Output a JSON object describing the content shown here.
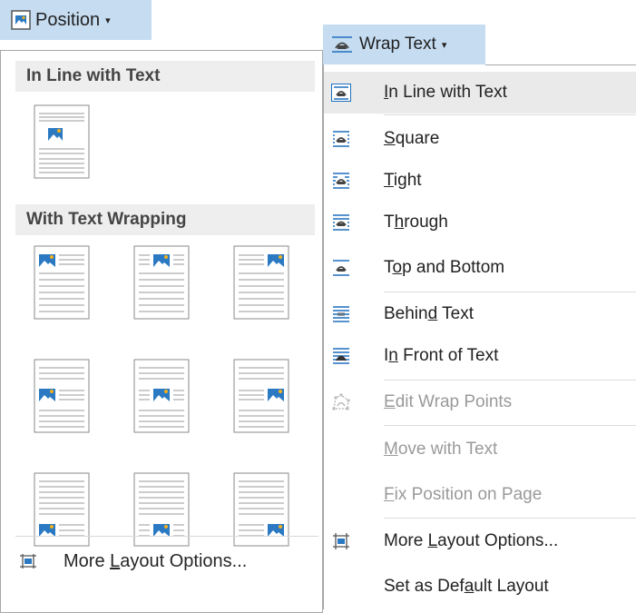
{
  "position_button": {
    "label": "Position",
    "caret": "▾",
    "icon": "position-image-icon"
  },
  "position_panel": {
    "in_line_heading": "In Line with Text",
    "with_wrap_heading": "With Text Wrapping",
    "more_layout": {
      "pre": "More ",
      "acc": "L",
      "post": "ayout Options...",
      "icon": "layout-options-icon"
    }
  },
  "wrap_button": {
    "label": "Wrap Text",
    "caret": "▾",
    "icon": "wrap-text-icon"
  },
  "wrap_menu": {
    "items": [
      {
        "pre": "",
        "acc": "I",
        "post": "n Line with Text",
        "icon": "inline-wrap-icon",
        "selected": true
      },
      {
        "pre": "",
        "acc": "S",
        "post": "quare",
        "icon": "square-wrap-icon"
      },
      {
        "pre": "",
        "acc": "T",
        "post": "ight",
        "icon": "tight-wrap-icon"
      },
      {
        "pre": "T",
        "acc": "h",
        "post": "rough",
        "icon": "through-wrap-icon"
      },
      {
        "pre": "T",
        "acc": "o",
        "post": "p and Bottom",
        "icon": "top-bottom-wrap-icon"
      },
      {
        "pre": "Behin",
        "acc": "d",
        "post": " Text",
        "icon": "behind-text-icon"
      },
      {
        "pre": "I",
        "acc": "n",
        "post": " Front of Text",
        "icon": "in-front-text-icon"
      },
      {
        "pre": "",
        "acc": "E",
        "post": "dit Wrap Points",
        "icon": "edit-wrap-points-icon",
        "disabled": true
      },
      {
        "pre": "",
        "acc": "M",
        "post": "ove with Text",
        "disabled": true
      },
      {
        "pre": "",
        "acc": "F",
        "post": "ix Position on Page",
        "disabled": true
      },
      {
        "pre": "More ",
        "acc": "L",
        "post": "ayout Options...",
        "icon": "layout-options-icon"
      },
      {
        "pre": "Set as Def",
        "acc": "a",
        "post": "ult Layout"
      }
    ]
  },
  "colors": {
    "button_highlight": "#c5dcf1",
    "icon_blue": "#1f6fbd",
    "heading_bg": "#eeeeee",
    "disabled_text": "#9a9a9a"
  }
}
